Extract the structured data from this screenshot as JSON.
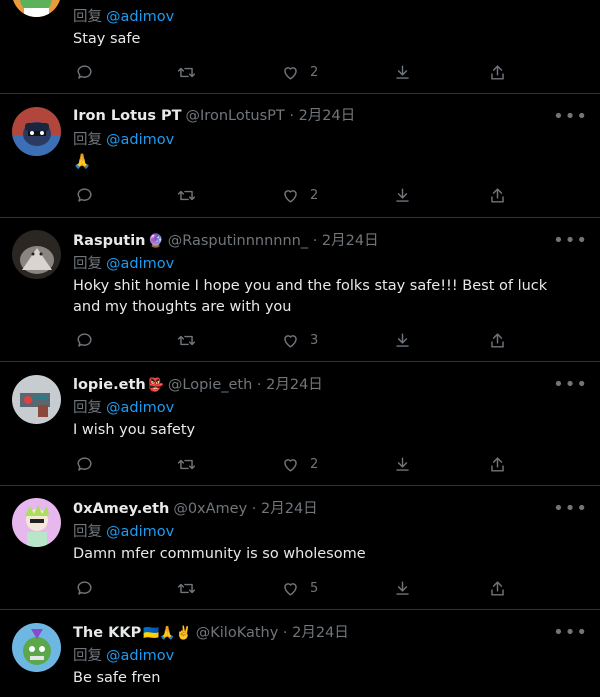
{
  "tweets": [
    {
      "name": "",
      "handle": "",
      "date": "",
      "badge": "",
      "reply_prefix": "回复",
      "reply_to": "@adimov",
      "text": "Stay safe",
      "likes": "2",
      "avatar_color": "#e89a3c"
    },
    {
      "name": "Iron Lotus PT",
      "handle": "@IronLotusPT · 2月24日",
      "badge": "",
      "reply_prefix": "回复",
      "reply_to": "@adimov",
      "text": "🙏",
      "likes": "2",
      "avatar_color": "#3b6fb6"
    },
    {
      "name": "Rasputin",
      "handle": "@Rasputinnnnnnn_ · 2月24日",
      "badge": "🔮",
      "reply_prefix": "回复",
      "reply_to": "@adimov",
      "text": "Hoky shit homie I hope you and the folks stay safe!!! Best of luck and my thoughts are with you",
      "likes": "3",
      "avatar_color": "#2a2622"
    },
    {
      "name": "lopie.eth",
      "handle": "@Lopie_eth · 2月24日",
      "badge": "👺",
      "reply_prefix": "回复",
      "reply_to": "@adimov",
      "text": "I wish you safety",
      "likes": "2",
      "avatar_color": "#c7ccd1"
    },
    {
      "name": "0xAmey.eth",
      "handle": "@0xAmey · 2月24日",
      "badge": "",
      "reply_prefix": "回复",
      "reply_to": "@adimov",
      "text": "Damn mfer community is so wholesome",
      "likes": "5",
      "avatar_color": "#e6b8ee"
    },
    {
      "name": "The KKP",
      "handle": "@KiloKathy · 2月24日",
      "badge": "🇺🇦🙏✌️",
      "reply_prefix": "回复",
      "reply_to": "@adimov",
      "text": "Be safe fren",
      "likes": "",
      "avatar_color": "#6fb7e3"
    }
  ],
  "more_label": "•••"
}
